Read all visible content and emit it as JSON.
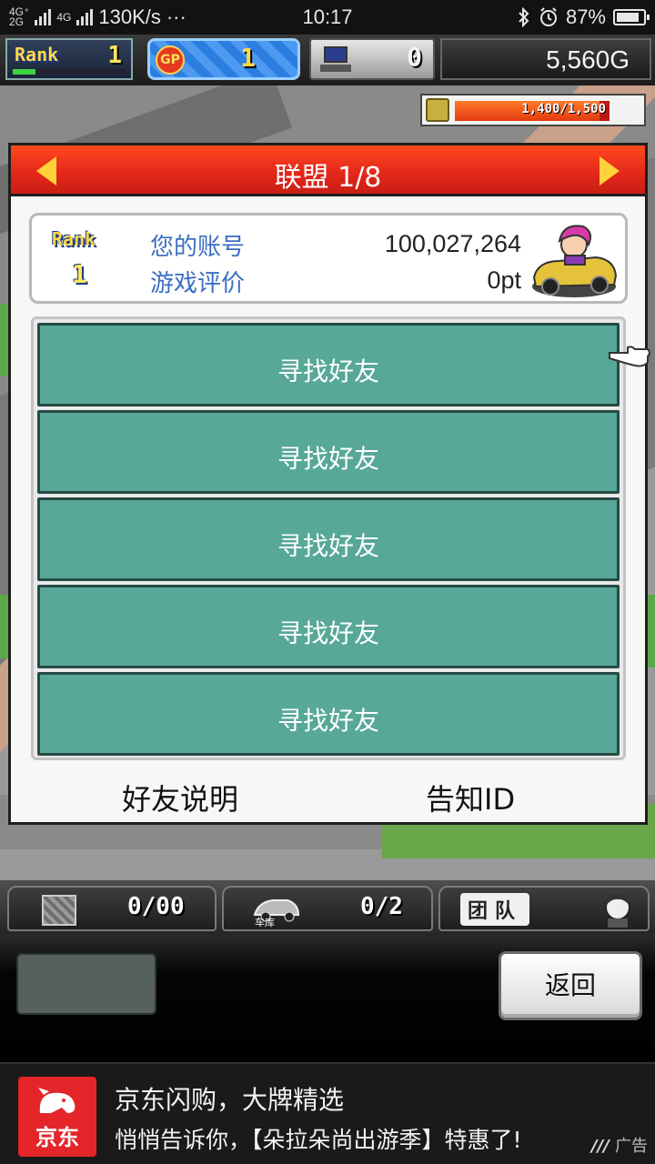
{
  "status_bar": {
    "network_labels": [
      "4G⁺",
      "4G",
      "2G"
    ],
    "speed": "130K/s",
    "more": "···",
    "time": "10:17",
    "battery": "87%",
    "battery_level": 0.87,
    "icons": [
      "bluetooth-icon",
      "alarm-icon",
      "battery-icon"
    ]
  },
  "hud": {
    "rank_label": "Rank",
    "rank_value": "1",
    "rank_progress": 0.2,
    "gp_label": "GP",
    "gp_value": "1",
    "pc_value": "0",
    "money": "5,560G"
  },
  "gauge": {
    "text": "1,400/1,500",
    "level": 0.933
  },
  "dialog": {
    "title": "联盟 1/8",
    "account": {
      "rank_label": "Rank",
      "rank_value": "1",
      "account_label": "您的账号",
      "account_value": "100,027,264",
      "rating_label": "游戏评价",
      "rating_value": "0pt"
    },
    "slots": [
      {
        "label": "寻找好友"
      },
      {
        "label": "寻找好友"
      },
      {
        "label": "寻找好友"
      },
      {
        "label": "寻找好友"
      },
      {
        "label": "寻找好友"
      }
    ],
    "help_link": "好友说明",
    "id_link": "告知ID"
  },
  "bottom_tabs": {
    "box_count": "0/00",
    "garage_count": "0/2",
    "garage_label": "车库",
    "team_label": "团队"
  },
  "panel": {
    "return_label": "返回"
  },
  "ad": {
    "logo_text": "京东",
    "title": "京东闪购，大牌精选",
    "subtitle": "悄悄告诉你，【朵拉朵尚出游季】特惠了!",
    "tag": "广告"
  },
  "colors": {
    "header_red": "#e6281a",
    "slot_teal": "#57a898",
    "label_blue": "#3a6ec2",
    "jd_red": "#e4262a"
  }
}
